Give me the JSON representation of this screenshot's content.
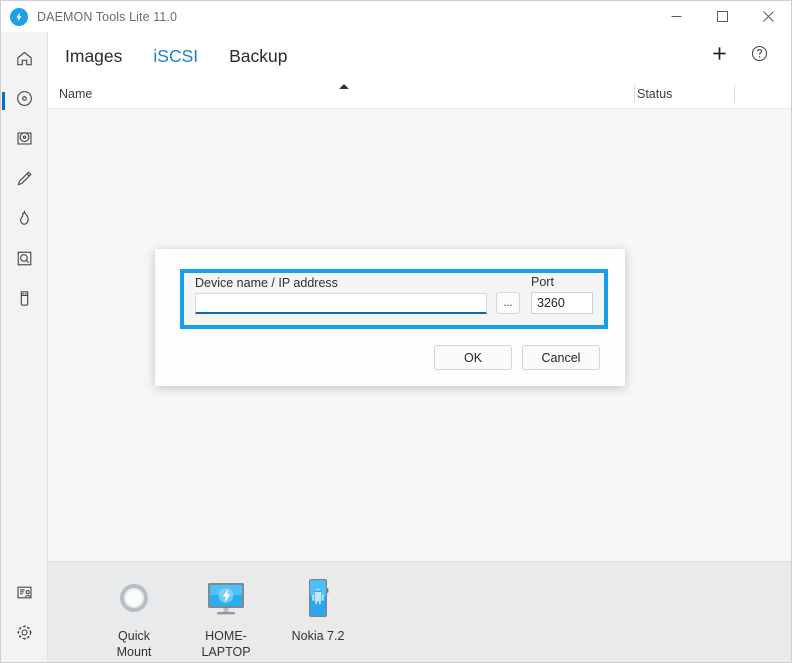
{
  "window": {
    "title": "DAEMON Tools Lite 11.0",
    "logo_icon": "daemon-lightning-logo",
    "minimize_label": "—",
    "maximize_label": "□",
    "close_label": "✕"
  },
  "sidebar": {
    "top_items": [
      {
        "name": "home",
        "icon": "home-icon"
      },
      {
        "name": "images",
        "icon": "disc-icon",
        "active": true
      },
      {
        "name": "virtual-drive",
        "icon": "disc-in-drive-icon"
      },
      {
        "name": "edit-image",
        "icon": "pencil-icon"
      },
      {
        "name": "burn",
        "icon": "flame-icon"
      },
      {
        "name": "image-catalog",
        "icon": "disc-frame-icon"
      },
      {
        "name": "usb-device",
        "icon": "usb-drive-icon"
      }
    ],
    "bottom_items": [
      {
        "name": "account",
        "icon": "account-card-icon"
      },
      {
        "name": "settings",
        "icon": "gear-icon"
      }
    ]
  },
  "tabs": [
    {
      "label": "Images",
      "active": false
    },
    {
      "label": "iSCSI",
      "active": true
    },
    {
      "label": "Backup",
      "active": false
    }
  ],
  "tab_actions": [
    {
      "name": "add",
      "icon": "plus-icon"
    },
    {
      "name": "help",
      "icon": "question-circle-icon"
    }
  ],
  "columns": {
    "name": "Name",
    "status": "Status",
    "sort_icon": "sort-ascending-arrow"
  },
  "dialog": {
    "device_label": "Device name / IP address",
    "device_value": "",
    "device_placeholder": "",
    "browse_label": "...",
    "port_label": "Port",
    "port_value": "3260",
    "ok_label": "OK",
    "cancel_label": "Cancel"
  },
  "dock": [
    {
      "label": "Quick Mount",
      "icon": "quick-mount-disc-icon"
    },
    {
      "label": "HOME-LAPTOP",
      "icon": "monitor-daemon-icon"
    },
    {
      "label": "Nokia 7.2",
      "icon": "android-phone-icon"
    }
  ],
  "colors": {
    "accent": "#1a7fd4",
    "focus_frame": "#13a2e8",
    "logo_blue": "#1f9fe8",
    "input_underline": "#1565a8"
  }
}
